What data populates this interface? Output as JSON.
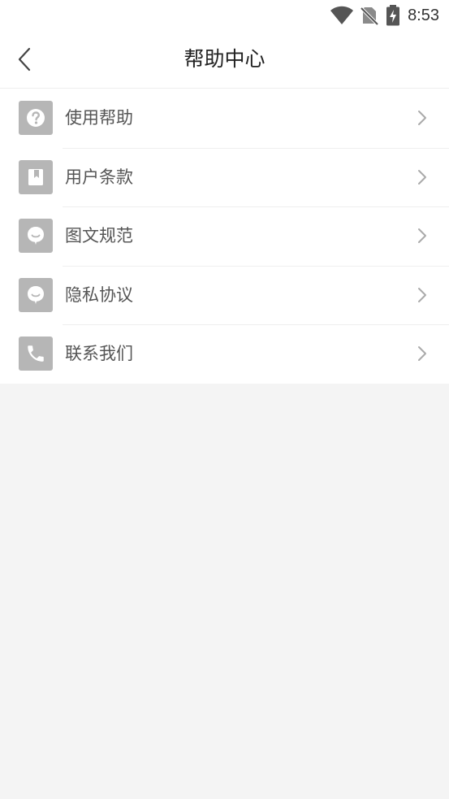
{
  "status_bar": {
    "time": "8:53",
    "icons": [
      "wifi-icon",
      "no-sim-icon",
      "battery-charging-icon"
    ]
  },
  "header": {
    "title": "帮助中心",
    "back_icon": "chevron-left-icon"
  },
  "menu": {
    "items": [
      {
        "label": "使用帮助",
        "icon": "question-icon"
      },
      {
        "label": "用户条款",
        "icon": "bookmark-icon"
      },
      {
        "label": "图文规范",
        "icon": "chat-bubble-icon"
      },
      {
        "label": "隐私协议",
        "icon": "chat-bubble-icon"
      },
      {
        "label": "联系我们",
        "icon": "phone-icon"
      }
    ]
  },
  "colors": {
    "background": "#f4f4f4",
    "surface": "#ffffff",
    "icon_tile": "#b6b6b6",
    "label_text": "#555555",
    "title_text": "#222222",
    "chevron": "#aaaaaa"
  }
}
